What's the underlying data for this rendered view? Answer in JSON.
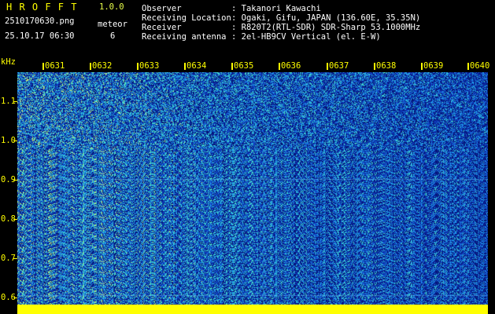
{
  "header": {
    "app_name": "H R O F F T",
    "version": "1.0.0",
    "filename": "2510170630.png",
    "timestamp": "25.10.17 06:30",
    "event_label": "meteor",
    "event_count": "6",
    "info": [
      {
        "label": "Observer",
        "value": ": Takanori Kawachi"
      },
      {
        "label": "Receiving Location",
        "value": ": Ogaki, Gifu, JAPAN (136.60E, 35.35N)"
      },
      {
        "label": "Receiver",
        "value": ": R820T2(RTL-SDR) SDR-Sharp 53.1000MHz"
      },
      {
        "label": "Receiving antenna",
        "value": ": 2el-HB9CV Vertical (el. E-W)"
      }
    ]
  },
  "axis": {
    "unit": "kHz",
    "y_ticks": [
      "1.1",
      "1.0",
      "0.9",
      "0.8",
      "0.7",
      "0.6"
    ],
    "time_ticks": [
      "0631",
      "0632",
      "0633",
      "0634",
      "0635",
      "0636",
      "0637",
      "0638",
      "0639",
      "0640"
    ]
  },
  "colors": {
    "background": "#000000",
    "text_primary": "#ffff00",
    "text_secondary": "#ffffff",
    "spectrogram_low": "#0a1a8c",
    "spectrogram_mid": "#1e64dc",
    "spectrogram_high": "#46dcc8",
    "baseline": "#ffff00"
  }
}
